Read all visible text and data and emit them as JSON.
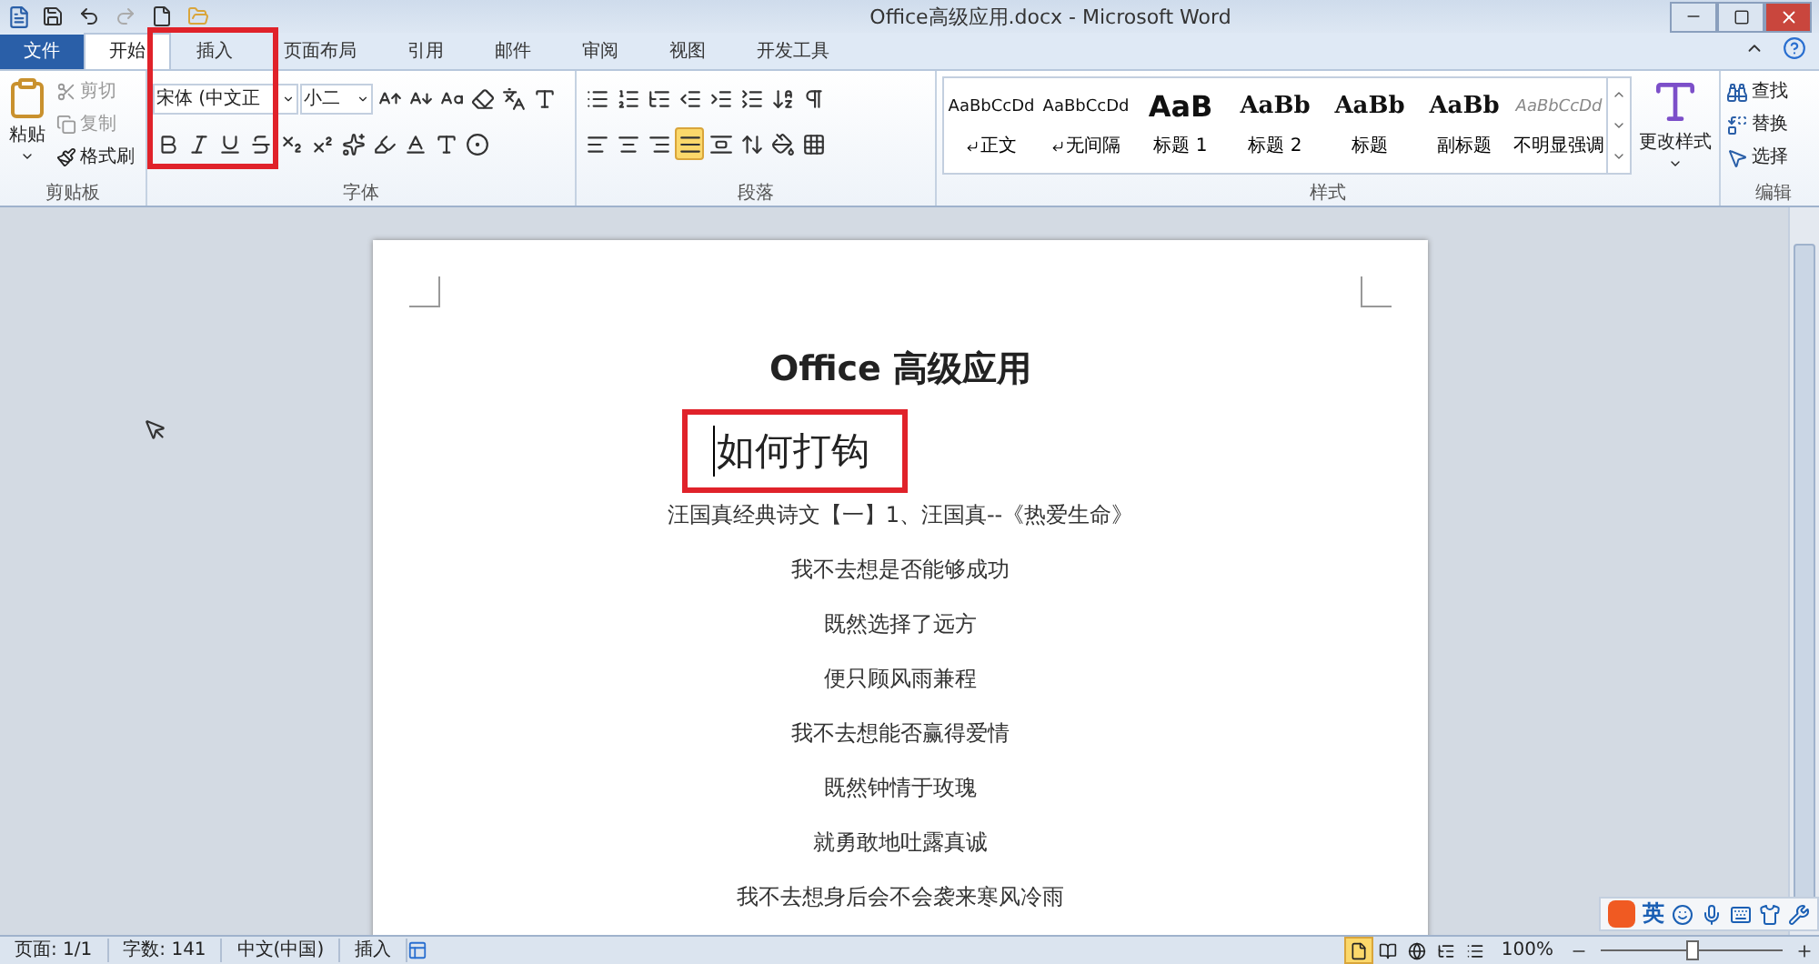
{
  "window": {
    "title": "Office高级应用.docx - Microsoft Word"
  },
  "tabs": [
    {
      "label": "文件",
      "kind": "file",
      "selected": false
    },
    {
      "label": "开始",
      "kind": "tab",
      "selected": true
    },
    {
      "label": "插入",
      "kind": "tab",
      "selected": false
    },
    {
      "label": "页面布局",
      "kind": "tab",
      "selected": false
    },
    {
      "label": "引用",
      "kind": "tab",
      "selected": false
    },
    {
      "label": "邮件",
      "kind": "tab",
      "selected": false
    },
    {
      "label": "审阅",
      "kind": "tab",
      "selected": false
    },
    {
      "label": "视图",
      "kind": "tab",
      "selected": false
    },
    {
      "label": "开发工具",
      "kind": "tab",
      "selected": false
    }
  ],
  "clipboard": {
    "paste": "粘贴",
    "items": [
      {
        "label": "剪切",
        "kind": "cut",
        "disabled": true
      },
      {
        "label": "复制",
        "kind": "copy",
        "disabled": true
      },
      {
        "label": "格式刷",
        "kind": "brush",
        "disabled": false
      }
    ],
    "group": "剪贴板"
  },
  "font": {
    "font_name": "宋体 (中文正",
    "font_size": "小二",
    "group": "字体"
  },
  "paragraph": {
    "align_buttons": [
      {
        "selected": false
      },
      {
        "selected": false
      },
      {
        "selected": false
      },
      {
        "selected": true
      },
      {
        "selected": false
      }
    ],
    "group": "段落"
  },
  "styles": {
    "items": [
      {
        "sample": "AaBbCcDd",
        "name": "正文",
        "kind": "body"
      },
      {
        "sample": "AaBbCcDd",
        "name": "无间隔",
        "kind": "body"
      },
      {
        "sample": "AaB",
        "name": "标题 1",
        "kind": "heading1"
      },
      {
        "sample": "AaBb",
        "name": "标题 2",
        "kind": "heading"
      },
      {
        "sample": "AaBb",
        "name": "标题",
        "kind": "heading"
      },
      {
        "sample": "AaBb",
        "name": "副标题",
        "kind": "heading"
      },
      {
        "sample": "AaBbCcDd",
        "name": "不明显强调",
        "kind": "subtle"
      }
    ],
    "change": "更改样式",
    "group": "样式"
  },
  "editing": {
    "items": [
      {
        "label": "查找",
        "kind": "find"
      },
      {
        "label": "替换",
        "kind": "replace"
      },
      {
        "label": "选择",
        "kind": "select"
      }
    ],
    "group": "编辑"
  },
  "document": {
    "title": "Office 高级应用",
    "subtitle": "如何打钩",
    "lines": [
      "汪国真经典诗文【一】1、汪国真--《热爱生命》",
      "我不去想是否能够成功",
      "既然选择了远方",
      "便只顾风雨兼程",
      "我不去想能否赢得爱情",
      "既然钟情于玫瑰",
      "就勇敢地吐露真诚",
      "我不去想身后会不会袭来寒风冷雨"
    ]
  },
  "annotations": {
    "ribbon_frame": true,
    "heading_frame": true
  },
  "ime": {
    "mode": "英"
  },
  "status_bar": {
    "items": [
      "页面: 1/1",
      "字数: 141",
      "中文(中国)",
      "插入"
    ],
    "zoom": "100%",
    "zoom_level": {
      "level": 0.5
    }
  }
}
